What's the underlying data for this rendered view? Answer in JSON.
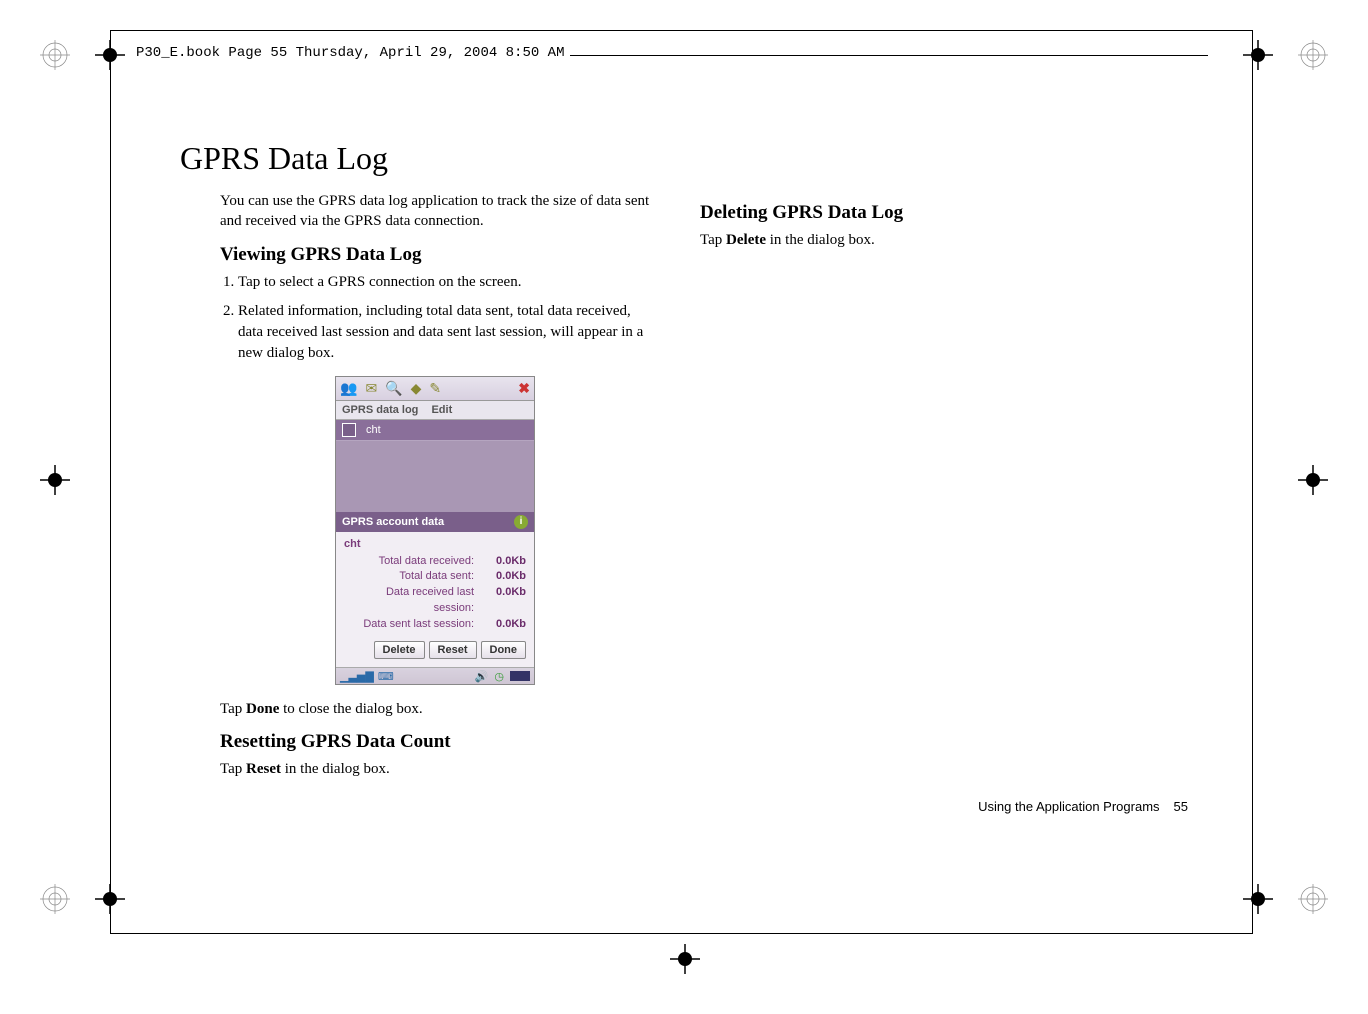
{
  "header": {
    "filepath": "P30_E.book  Page 55  Thursday, April 29, 2004  8:50 AM"
  },
  "title": "GPRS Data Log",
  "left": {
    "intro": "You can use the GPRS data log application to track the size of data sent and received via the GPRS data connection.",
    "section1": "Viewing GPRS Data Log",
    "step1": "Tap to select a GPRS connection on the screen.",
    "step2": "Related information, including total data sent, total data received, data received last session and data sent last session, will appear in a new dialog box.",
    "afterImg_pre": "Tap ",
    "afterImg_bold": "Done",
    "afterImg_post": " to close the dialog box.",
    "section2": "Resetting GPRS Data Count",
    "reset_pre": "Tap ",
    "reset_bold": "Reset",
    "reset_post": " in the dialog box."
  },
  "right": {
    "section1": "Deleting GPRS Data Log",
    "del_pre": "Tap ",
    "del_bold": "Delete",
    "del_post": " in the dialog box."
  },
  "screenshot": {
    "menu1": "GPRS data log",
    "menu2": "Edit",
    "listItem": "cht",
    "panelHeader": "GPRS account data",
    "accountName": "cht",
    "rows": [
      {
        "lbl": "Total data received:",
        "val": "0.0Kb"
      },
      {
        "lbl": "Total data sent:",
        "val": "0.0Kb"
      },
      {
        "lbl": "Data received last session:",
        "val": "0.0Kb"
      },
      {
        "lbl": "Data sent last session:",
        "val": "0.0Kb"
      }
    ],
    "buttons": {
      "delete": "Delete",
      "reset": "Reset",
      "done": "Done"
    }
  },
  "footer": {
    "chapter": "Using the Application Programs",
    "page": "55"
  }
}
